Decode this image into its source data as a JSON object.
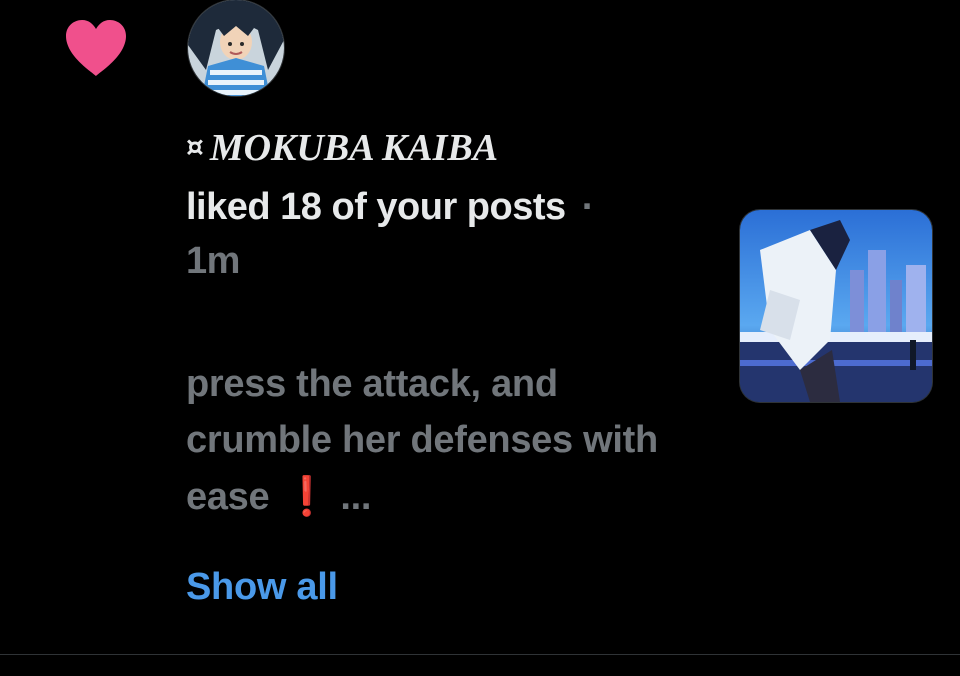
{
  "notification": {
    "type_icon": "heart-icon",
    "user": {
      "name_symbol": "¤",
      "display_name": "MOKUBA KAIBA",
      "avatar_icon": "avatar"
    },
    "action_text": "liked 18 of your posts",
    "separator": "·",
    "timestamp": "1m",
    "post_excerpt_part1": "press the attack, and crumble her defenses with ease",
    "post_excerpt_emoji": "❗",
    "post_excerpt_ellipsis": "...",
    "show_all_label": "Show all"
  },
  "colors": {
    "background": "#000000",
    "primary_text": "#e7e9ea",
    "secondary_text": "#71767b",
    "link": "#4a99e9",
    "heart": "#f0508c",
    "divider": "#2f3336"
  }
}
